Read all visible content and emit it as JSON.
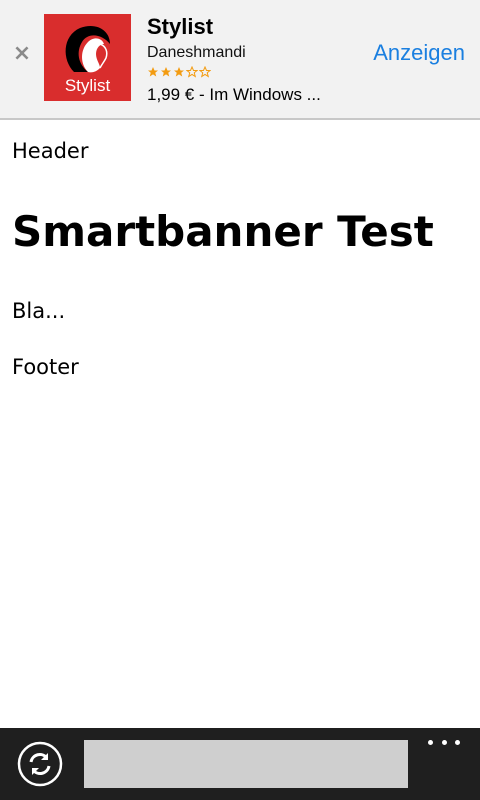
{
  "smartbanner": {
    "close_glyph": "×",
    "app_icon_label": "Stylist",
    "title": "Stylist",
    "author": "Daneshmandi",
    "rating": {
      "filled": 3,
      "total": 5
    },
    "price": "1,99 € - Im Windows ...",
    "button_label": "Anzeigen",
    "icon_name": "stylist-app-icon",
    "colors": {
      "background": "#f2f2f2",
      "icon_background": "#d92d2d",
      "button": "#1a7fe0",
      "star_filled": "#f39c12"
    }
  },
  "page": {
    "header": "Header",
    "title": "Smartbanner Test",
    "body": "Bla...",
    "footer": "Footer"
  },
  "browser_bar": {
    "refresh_icon": "refresh-icon",
    "address_value": "",
    "more_icon": "more-icon",
    "colors": {
      "background": "#1f1f1f",
      "address_bar": "#cfcfcf"
    }
  }
}
